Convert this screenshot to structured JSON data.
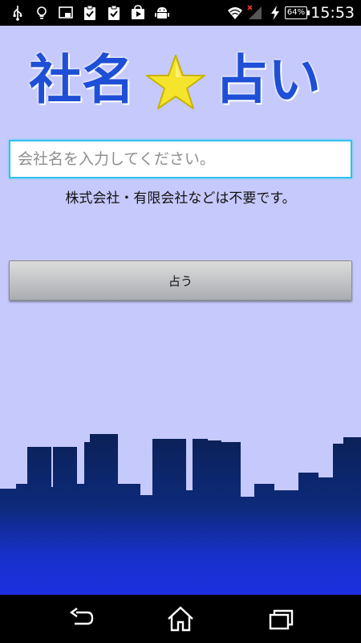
{
  "status_bar": {
    "left_icons": [
      "usb-icon",
      "lightbulb-icon",
      "cast-icon",
      "clipboard-check-icon",
      "clipboard-check-icon",
      "play-store-icon",
      "android-icon"
    ],
    "right_icons": [
      "wifi-icon",
      "signal-icon",
      "charging-icon"
    ],
    "battery": "64%",
    "time": "15:53"
  },
  "app": {
    "logo": {
      "part1": "社名",
      "part2": "占い",
      "star_color": "#f5e32c",
      "text_color": "#1e4fd6"
    },
    "input": {
      "placeholder": "会社名を入力してください。",
      "value": ""
    },
    "note": "株式会社・有限会社などは不要です。",
    "button": {
      "label": "占う"
    },
    "colors": {
      "background": "#c6c9fb",
      "skyline_top": "#0b2157",
      "skyline_bottom": "#1d2fe0"
    }
  },
  "nav_bar": {
    "buttons": [
      "back-icon",
      "home-icon",
      "recent-apps-icon"
    ]
  }
}
